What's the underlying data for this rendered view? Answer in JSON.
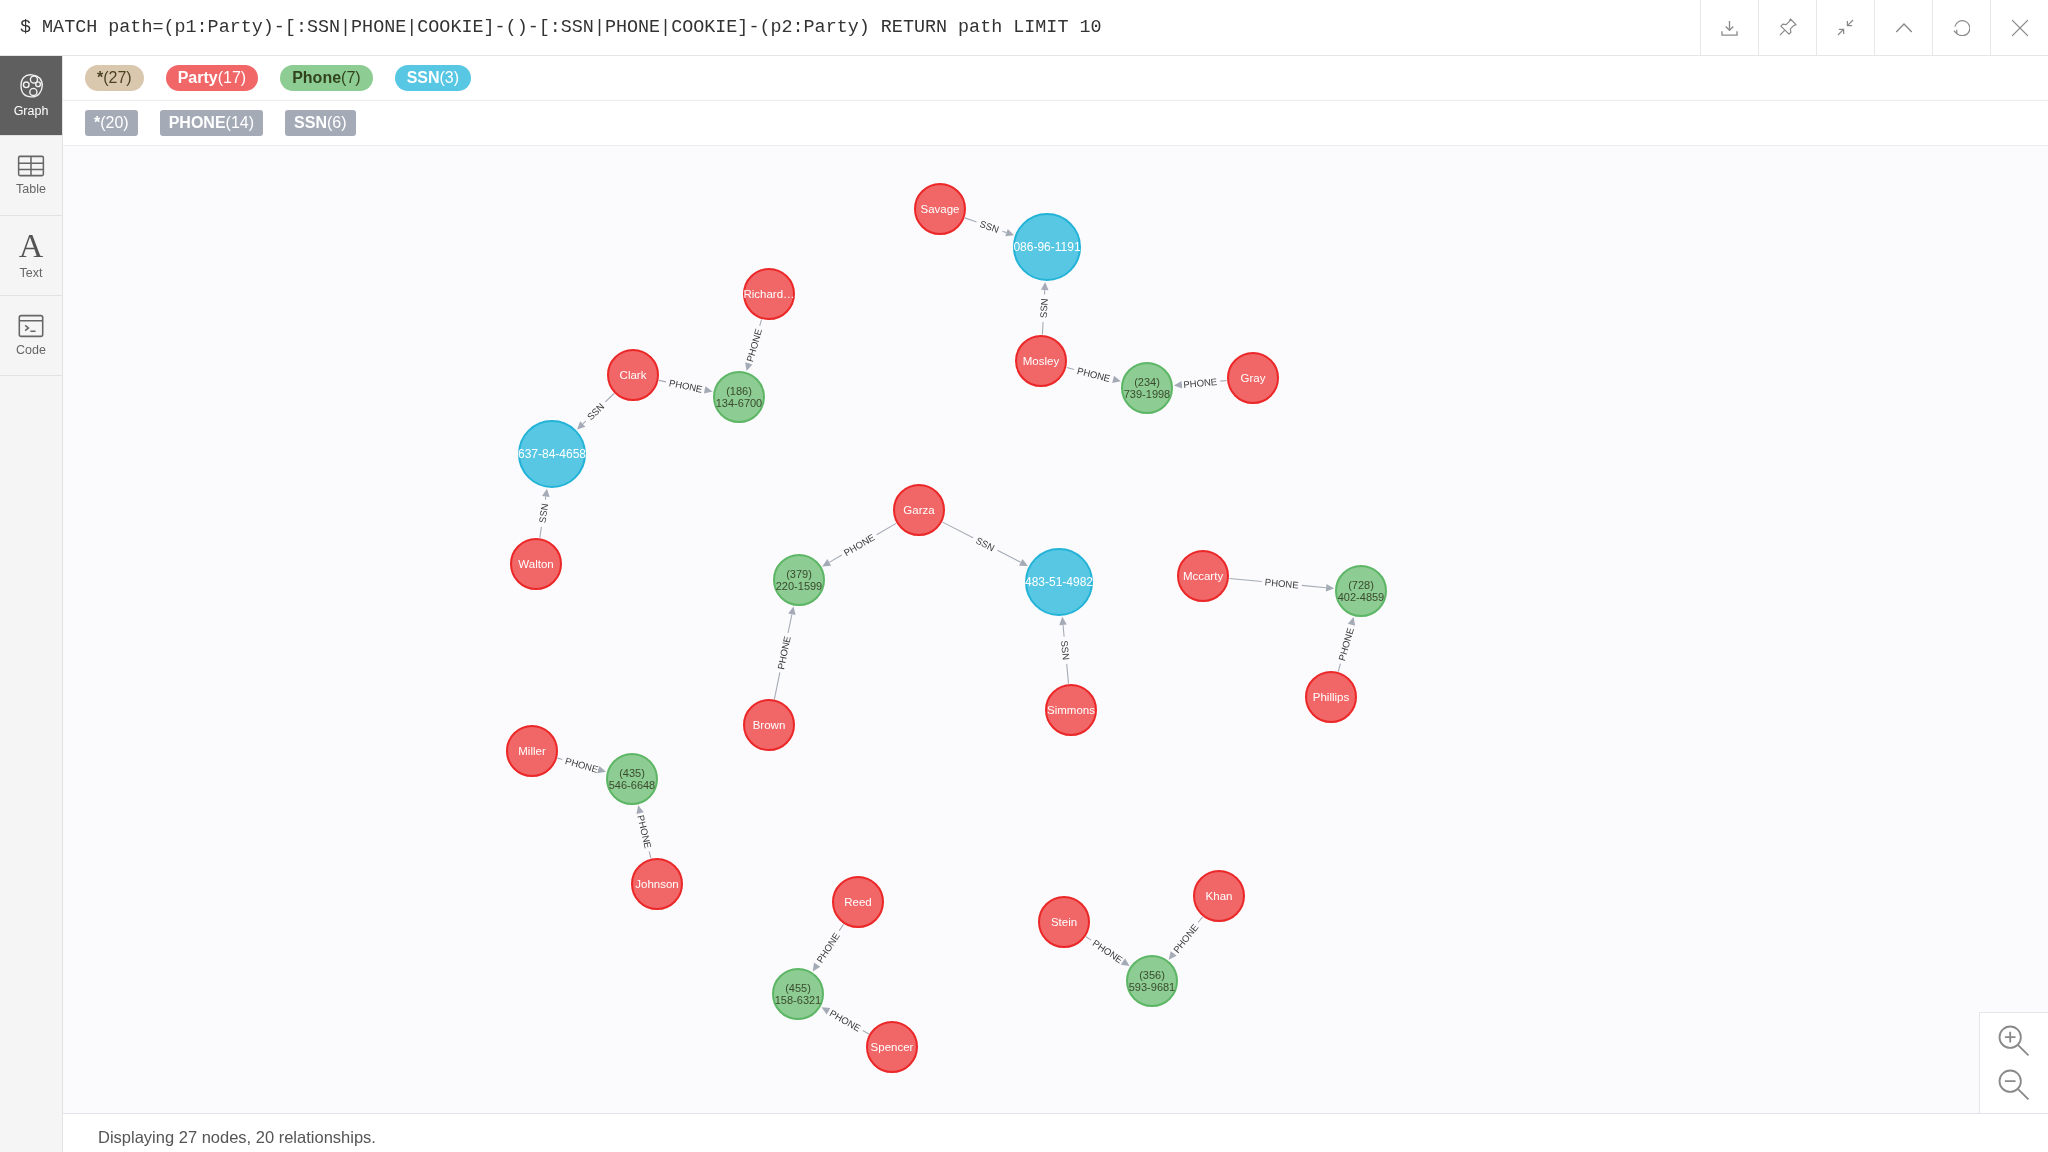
{
  "editor": {
    "query": "$ MATCH path=(p1:Party)-[:SSN|PHONE|COOKIE]-()-[:SSN|PHONE|COOKIE]-(p2:Party) RETURN path LIMIT 10"
  },
  "sidebar": {
    "items": [
      {
        "kind": "graph",
        "label": "Graph",
        "selected": true
      },
      {
        "kind": "table",
        "label": "Table",
        "selected": false
      },
      {
        "kind": "text",
        "glyph": "A",
        "label": "Text",
        "selected": false
      },
      {
        "kind": "code",
        "label": "Code",
        "selected": false
      }
    ]
  },
  "legend": {
    "node_labels": [
      {
        "label": "*",
        "count": "(27)",
        "color": "#d9c8ae"
      },
      {
        "label": "Party",
        "count": "(17)",
        "color": "#f16667"
      },
      {
        "label": "Phone",
        "count": "(7)",
        "color": "#8dcc93"
      },
      {
        "label": "SSN",
        "count": "(3)",
        "color": "#57c7e3"
      }
    ],
    "relationship_types": [
      {
        "label": "*",
        "count": "(20)"
      },
      {
        "label": "PHONE",
        "count": "(14)"
      },
      {
        "label": "SSN",
        "count": "(6)"
      }
    ]
  },
  "graph": {
    "nodes": [
      {
        "kind": "party",
        "caption": "Savage"
      },
      {
        "kind": "ssn",
        "caption": "086-96-1191"
      },
      {
        "kind": "party",
        "caption": "Richard…"
      },
      {
        "kind": "party",
        "caption": "Mosley"
      },
      {
        "kind": "party",
        "caption": "Clark"
      },
      {
        "kind": "phone",
        "caption": "(186) 134-6700"
      },
      {
        "kind": "phone",
        "caption": "(234) 739-1998"
      },
      {
        "kind": "party",
        "caption": "Gray"
      },
      {
        "kind": "ssn",
        "caption": "637-84-4658"
      },
      {
        "kind": "party",
        "caption": "Garza"
      },
      {
        "kind": "party",
        "caption": "Mccarty"
      },
      {
        "kind": "party",
        "caption": "Walton"
      },
      {
        "kind": "phone",
        "caption": "(379) 220-1599"
      },
      {
        "kind": "ssn",
        "caption": "483-51-4982"
      },
      {
        "kind": "phone",
        "caption": "(728) 402-4859"
      },
      {
        "kind": "party",
        "caption": "Phillips"
      },
      {
        "kind": "party",
        "caption": "Simmons"
      },
      {
        "kind": "party",
        "caption": "Brown"
      },
      {
        "kind": "party",
        "caption": "Miller"
      },
      {
        "kind": "phone",
        "caption": "(435) 546-6648"
      },
      {
        "kind": "party",
        "caption": "Johnson"
      },
      {
        "kind": "party",
        "caption": "Khan"
      },
      {
        "kind": "party",
        "caption": "Reed"
      },
      {
        "kind": "party",
        "caption": "Stein"
      },
      {
        "kind": "phone",
        "caption": "(356) 593-9681"
      },
      {
        "kind": "phone",
        "caption": "(455) 158-6321"
      },
      {
        "kind": "party",
        "caption": "Spencer"
      }
    ],
    "relationships": [
      {
        "type": "SSN"
      },
      {
        "type": "SSN"
      },
      {
        "type": "PHONE"
      },
      {
        "type": "PHONE"
      },
      {
        "type": "PHONE"
      },
      {
        "type": "PHONE"
      },
      {
        "type": "SSN"
      },
      {
        "type": "SSN"
      },
      {
        "type": "PHONE"
      },
      {
        "type": "SSN"
      },
      {
        "type": "PHONE"
      },
      {
        "type": "SSN"
      },
      {
        "type": "PHONE"
      },
      {
        "type": "PHONE"
      },
      {
        "type": "PHONE"
      },
      {
        "type": "PHONE"
      },
      {
        "type": "PHONE"
      },
      {
        "type": "PHONE"
      },
      {
        "type": "PHONE"
      },
      {
        "type": "PHONE"
      }
    ]
  },
  "status_bar": {
    "text": "Displaying 27 nodes, 20 relationships."
  }
}
